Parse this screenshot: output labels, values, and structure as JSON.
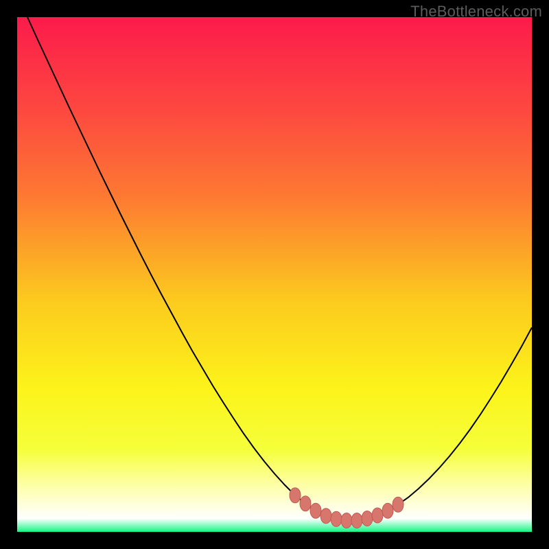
{
  "attribution": "TheBottleneck.com",
  "colors": {
    "frame": "#000000",
    "curve": "#000000",
    "marker_fill": "#d6766d",
    "marker_stroke": "#c05a52",
    "gradient_stops": [
      {
        "offset": 0.0,
        "color": "#fc1b4b"
      },
      {
        "offset": 0.18,
        "color": "#fd4840"
      },
      {
        "offset": 0.35,
        "color": "#fd7a32"
      },
      {
        "offset": 0.55,
        "color": "#fcca1e"
      },
      {
        "offset": 0.72,
        "color": "#fcf31a"
      },
      {
        "offset": 0.84,
        "color": "#f5ff3a"
      },
      {
        "offset": 0.9,
        "color": "#fdff99"
      },
      {
        "offset": 0.955,
        "color": "#ffffe6"
      },
      {
        "offset": 0.974,
        "color": "#ffffff"
      },
      {
        "offset": 1.0,
        "color": "#13f783"
      }
    ]
  },
  "chart_data": {
    "type": "line",
    "title": "",
    "xlabel": "",
    "ylabel": "",
    "xlim": [
      0,
      100
    ],
    "ylim": [
      0,
      100
    ],
    "x": [
      2,
      4,
      6,
      8,
      10,
      12,
      14,
      16,
      18,
      20,
      22,
      24,
      26,
      28,
      30,
      32,
      34,
      36,
      38,
      40,
      42,
      44,
      46,
      48,
      50,
      52,
      54,
      56,
      58,
      60,
      62,
      64,
      66,
      68,
      70,
      72,
      74,
      76,
      78,
      80,
      82,
      84,
      86,
      88,
      90,
      92,
      94,
      96,
      98,
      100
    ],
    "values": [
      100.0,
      95.6,
      91.3,
      87.0,
      82.7,
      78.5,
      74.3,
      70.1,
      66.0,
      61.9,
      57.9,
      53.9,
      50.0,
      46.2,
      42.5,
      38.8,
      35.2,
      31.8,
      28.4,
      25.2,
      22.1,
      19.1,
      16.3,
      13.7,
      11.3,
      9.1,
      7.1,
      5.5,
      4.1,
      3.1,
      2.5,
      2.2,
      2.2,
      2.6,
      3.2,
      4.1,
      5.3,
      6.7,
      8.4,
      10.3,
      12.4,
      14.7,
      17.2,
      19.9,
      22.8,
      25.9,
      29.1,
      32.5,
      36.0,
      39.7
    ],
    "markers": {
      "x": [
        54,
        56,
        58,
        60,
        62,
        64,
        66,
        68,
        70,
        72,
        74
      ],
      "y": [
        7.1,
        5.5,
        4.1,
        3.1,
        2.5,
        2.2,
        2.2,
        2.6,
        3.2,
        4.1,
        5.3
      ]
    }
  }
}
